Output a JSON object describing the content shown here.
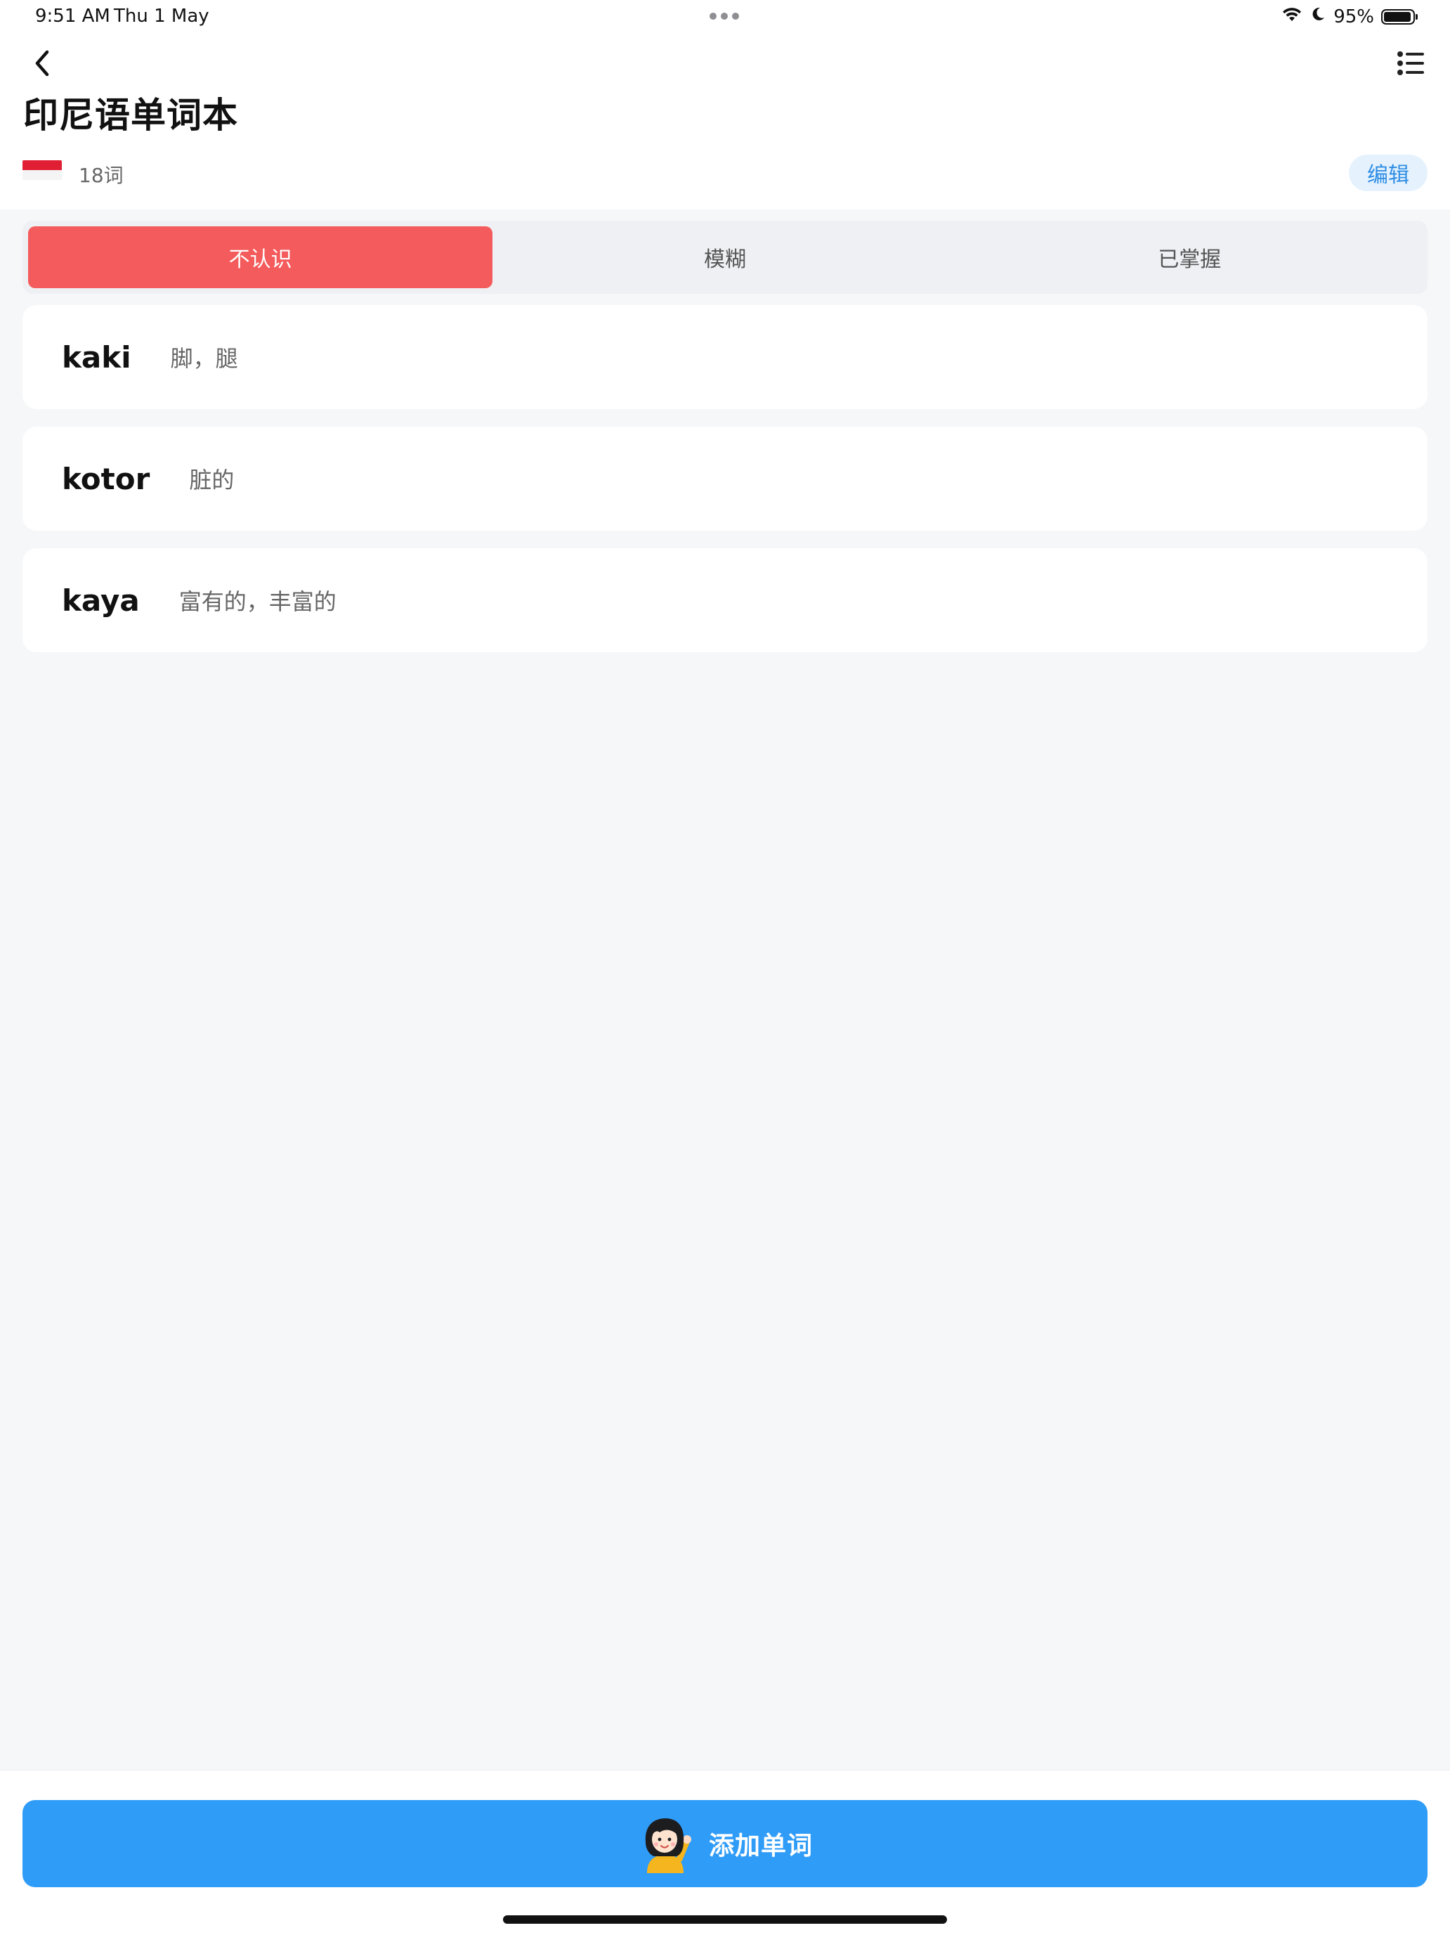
{
  "status_bar": {
    "time": "9:51 AM",
    "date": "Thu 1 May",
    "battery_text": "95%",
    "battery_level": 0.95
  },
  "header": {
    "title": "印尼语单词本",
    "word_count": "18词",
    "edit_label": "编辑",
    "flag_colors": {
      "top": "#e11f34",
      "bottom": "#f4f4f4"
    }
  },
  "tabs": [
    {
      "label": "不认识",
      "active": true
    },
    {
      "label": "模糊",
      "active": false
    },
    {
      "label": "已掌握",
      "active": false
    }
  ],
  "words": [
    {
      "word": "kaki",
      "meaning": "脚，腿"
    },
    {
      "word": "kotor",
      "meaning": "脏的"
    },
    {
      "word": "kaya",
      "meaning": "富有的，丰富的"
    }
  ],
  "add_button": {
    "label": "添加单词",
    "icon": "waving-girl-icon"
  },
  "colors": {
    "accent_red": "#f45b5c",
    "accent_blue": "#2f9cf8",
    "edit_blue": "#2f8de4"
  }
}
